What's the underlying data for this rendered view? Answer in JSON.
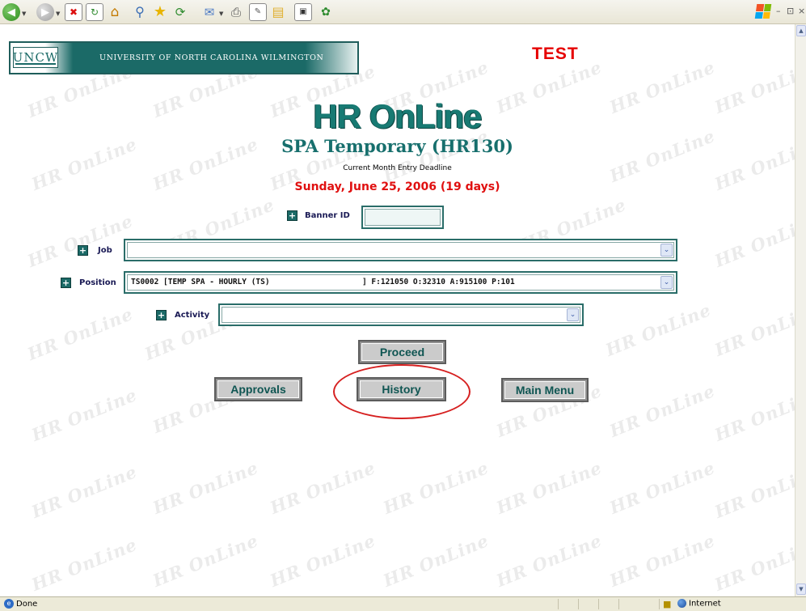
{
  "browser": {
    "toolbar_icons": [
      "back-icon",
      "forward-icon",
      "stop-icon",
      "refresh-icon",
      "home-icon",
      "search-icon",
      "favorites-icon",
      "history-icon",
      "mail-icon",
      "print-icon",
      "edit-icon",
      "discuss-icon",
      "research-icon",
      "messenger-icon"
    ],
    "status_text": "Done",
    "zone_text": "Internet"
  },
  "header": {
    "university": "UNIVERSITY OF NORTH CAROLINA WILMINGTON",
    "logo_text": "UNCW",
    "test_label": "TEST"
  },
  "app": {
    "title": "HR OnLine",
    "form_title": "SPA Temporary (HR130)",
    "deadline_label": "Current Month Entry Deadline",
    "deadline_date": "Sunday, June 25, 2006 (19 days)"
  },
  "form": {
    "banner_id_label": "Banner ID",
    "banner_id_value": "",
    "job_label": "Job",
    "job_value": "",
    "position_label": "Position",
    "position_value": "TS0002 [TEMP SPA - HOURLY (TS)                    ] F:121050 O:32310 A:915100 P:101",
    "activity_label": "Activity",
    "activity_value": ""
  },
  "buttons": {
    "proceed": "Proceed",
    "approvals": "Approvals",
    "history": "History",
    "main_menu": "Main Menu"
  },
  "annotation": {
    "highlight_color": "#d62020",
    "highlighted": "History"
  },
  "colors": {
    "brand_teal": "#1b6a67",
    "alert_red": "#e60000"
  }
}
